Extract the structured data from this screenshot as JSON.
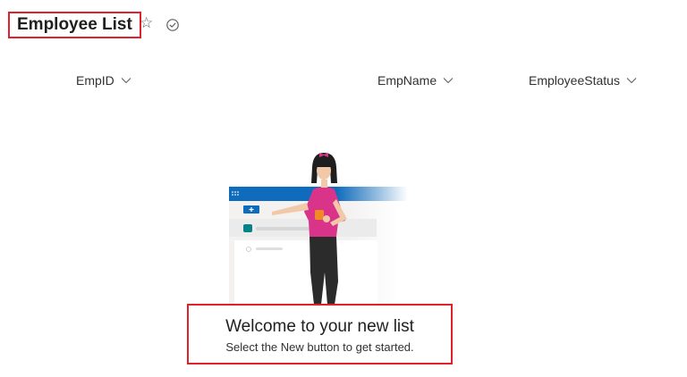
{
  "header": {
    "title": "Employee List",
    "favorite_icon": "star-outline-icon",
    "status_icon": "check-circle-icon"
  },
  "columns": [
    {
      "label": "EmpID"
    },
    {
      "label": "EmpName"
    },
    {
      "label": "EmployeeStatus"
    }
  ],
  "empty_state": {
    "title": "Welcome to your new list",
    "subtitle": "Select the New button to get started."
  },
  "colors": {
    "highlight_border": "#e0202a",
    "accent_blue": "#0f6cbd",
    "shirt_pink": "#d9338a",
    "teal": "#038387"
  }
}
